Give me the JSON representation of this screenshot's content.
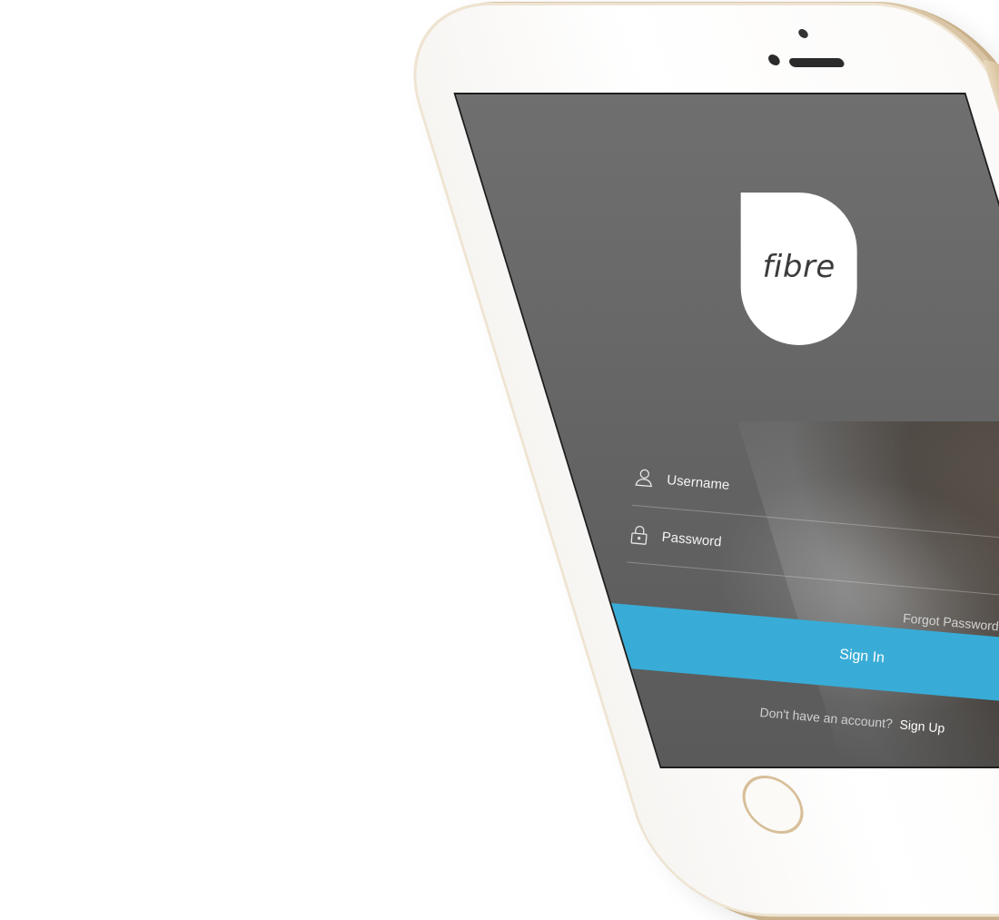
{
  "app": {
    "logo_text": "fibre"
  },
  "login": {
    "username_placeholder": "Username",
    "password_placeholder": "Password",
    "forgot_password": "Forgot Password",
    "sign_in": "Sign In",
    "no_account_text": "Don't have an account?",
    "sign_up": "Sign Up"
  },
  "icons": {
    "username": "user-icon",
    "password": "lock-icon"
  },
  "colors": {
    "accent": "#38acd6",
    "screen_bg": "#6a6a6a",
    "phone_gold": "#d6bd96",
    "phone_face": "#ffffff"
  }
}
